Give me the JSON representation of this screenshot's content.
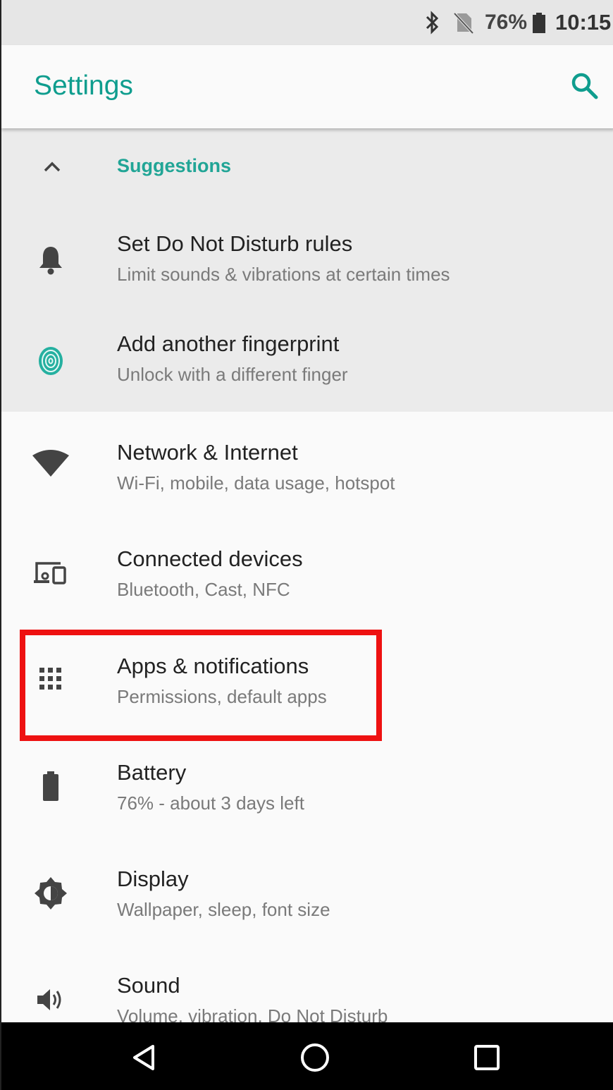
{
  "status_bar": {
    "battery_text": "76%",
    "time": "10:15",
    "icons": [
      "bluetooth-icon",
      "no-sim-icon",
      "battery-icon"
    ]
  },
  "app_bar": {
    "title": "Settings",
    "search_icon": "search-icon"
  },
  "suggestions": {
    "header": "Suggestions",
    "toggle_icon": "chevron-up-icon",
    "items": [
      {
        "icon": "bell-icon",
        "title": "Set Do Not Disturb rules",
        "subtitle": "Limit sounds & vibrations at certain times"
      },
      {
        "icon": "fingerprint-icon",
        "title": "Add another fingerprint",
        "subtitle": "Unlock with a different finger"
      }
    ]
  },
  "settings": {
    "items": [
      {
        "icon": "wifi-icon",
        "title": "Network & Internet",
        "subtitle": "Wi-Fi, mobile, data usage, hotspot"
      },
      {
        "icon": "devices-icon",
        "title": "Connected devices",
        "subtitle": "Bluetooth, Cast, NFC"
      },
      {
        "icon": "apps-grid-icon",
        "title": "Apps & notifications",
        "subtitle": "Permissions, default apps",
        "highlighted": true
      },
      {
        "icon": "battery-icon",
        "title": "Battery",
        "subtitle": "76% - about 3 days left"
      },
      {
        "icon": "brightness-icon",
        "title": "Display",
        "subtitle": "Wallpaper, sleep, font size"
      },
      {
        "icon": "volume-icon",
        "title": "Sound",
        "subtitle": "Volume, vibration, Do Not Disturb"
      }
    ]
  },
  "nav_bar": {
    "buttons": [
      "back-icon",
      "home-icon",
      "recents-icon"
    ]
  },
  "colors": {
    "accent": "#0f9d8e",
    "highlight": "#ee1111",
    "suggestions_bg": "#ebebeb"
  }
}
